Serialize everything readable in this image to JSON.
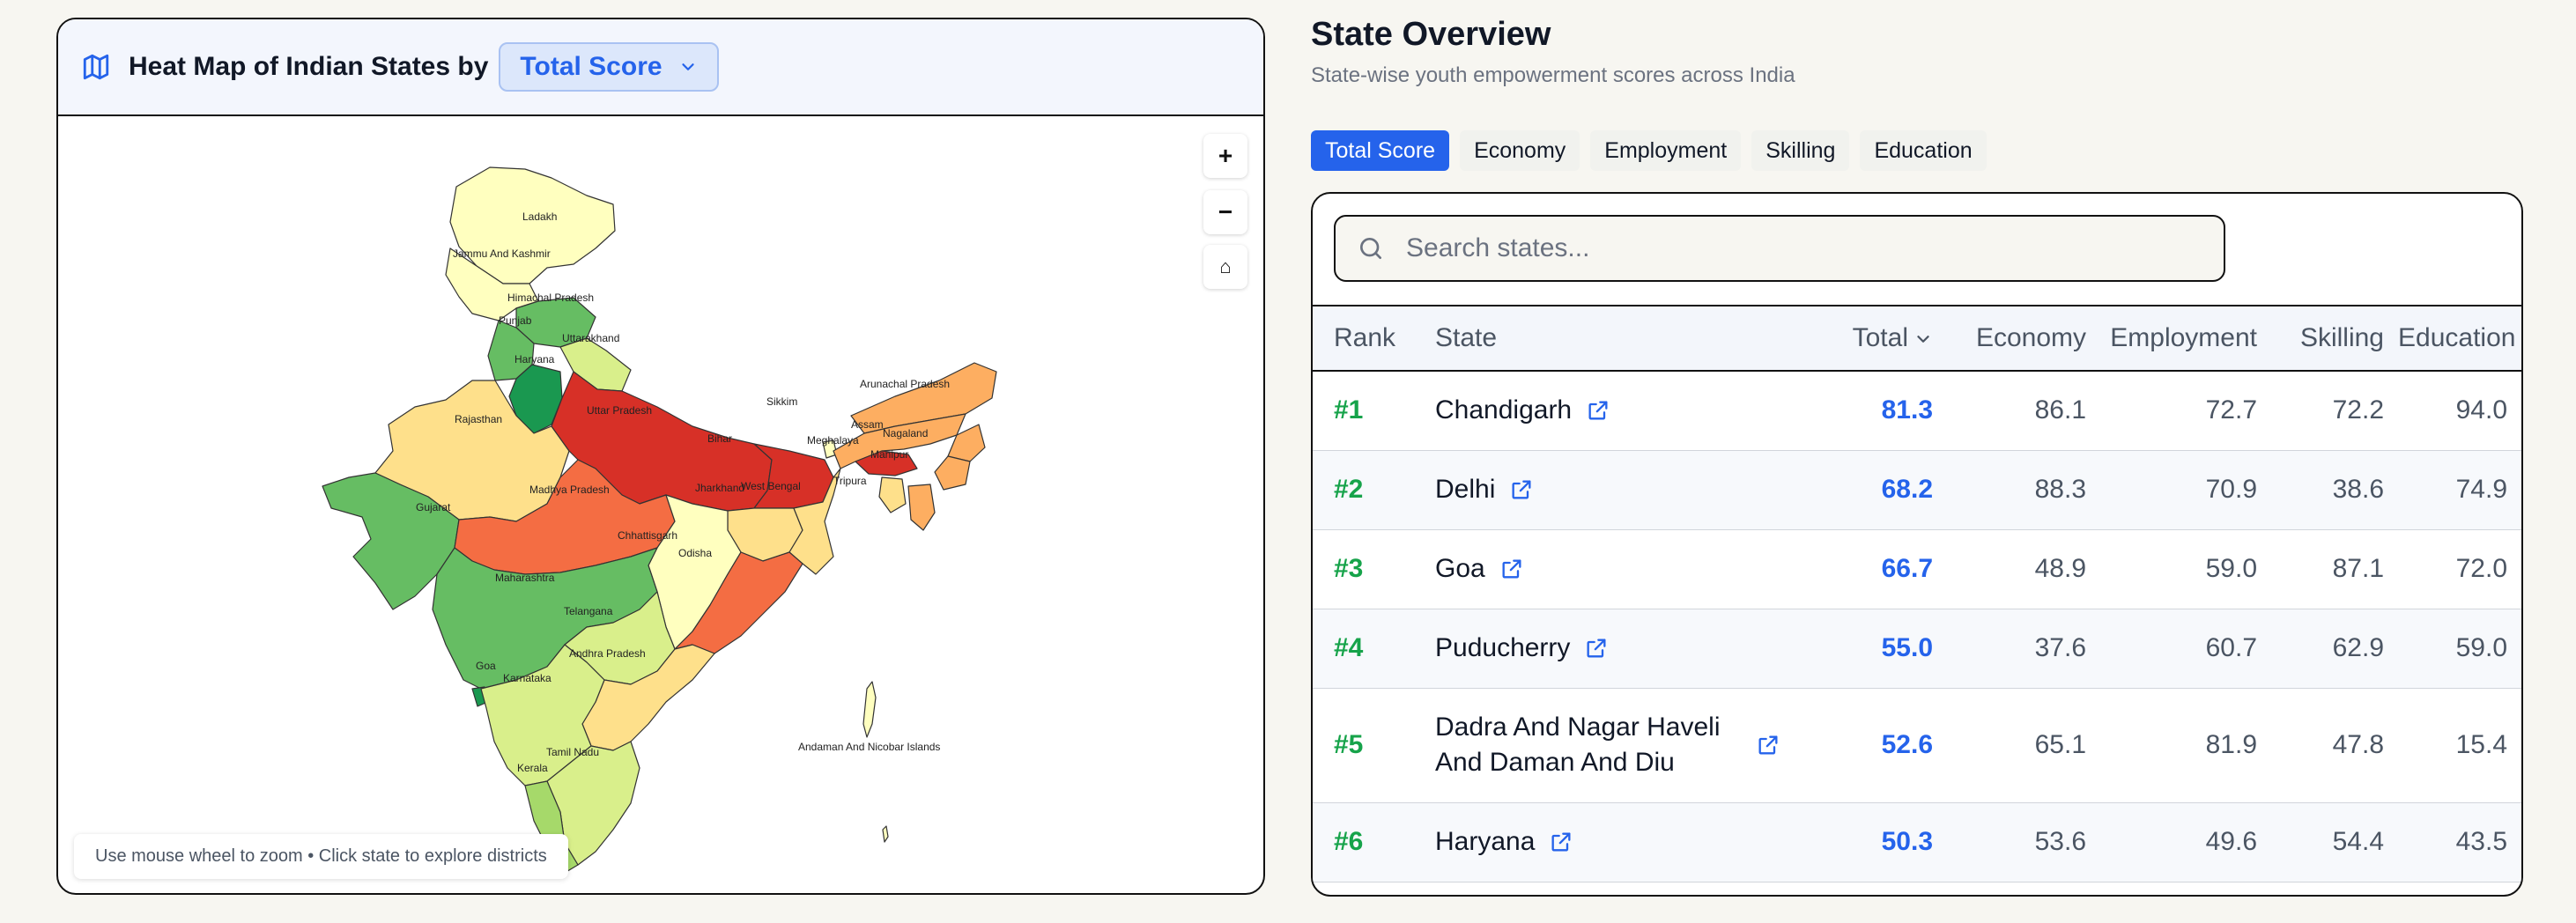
{
  "map": {
    "title": "Heat Map of Indian States by",
    "selected_metric": "Total Score",
    "hint": "Use mouse wheel to zoom • Click state to explore districts",
    "zoom_in": "+",
    "zoom_out": "−",
    "reset": "⌂",
    "labels": {
      "ladakh": "Ladakh",
      "jk": "Jammu And Kashmir",
      "hp": "Himachal Pradesh",
      "punjab": "Punjab",
      "uttarakhand": "Uttarakhand",
      "haryana": "Haryana",
      "rajasthan": "Rajasthan",
      "up": "Uttar Pradesh",
      "bihar": "Bihar",
      "sikkim": "Sikkim",
      "arunachal": "Arunachal Pradesh",
      "assam": "Assam",
      "nagaland": "Nagaland",
      "meghalaya": "Meghalaya",
      "manipur": "Manipur",
      "tripura": "Tripura",
      "gujarat": "Gujarat",
      "mp": "Madhya Pradesh",
      "jharkhand": "Jharkhand",
      "wb": "West Bengal",
      "chhattisgarh": "Chhattisgarh",
      "odisha": "Odisha",
      "maharashtra": "Maharashtra",
      "telangana": "Telangana",
      "ap": "Andhra Pradesh",
      "goa": "Goa",
      "karnataka": "Karnataka",
      "tn": "Tamil Nadu",
      "kerala": "Kerala",
      "andaman": "Andaman And Nicobar Islands"
    },
    "colors": {
      "dark_green": "#1a9850",
      "green": "#66bd63",
      "light_green": "#a6d96a",
      "yellow_green": "#d9ef8b",
      "pale_yellow": "#ffffbf",
      "light_orange": "#fee08b",
      "orange": "#fdae61",
      "dark_orange": "#f46d43",
      "red": "#d73027"
    }
  },
  "overview": {
    "title": "State Overview",
    "subtitle": "State-wise youth empowerment scores across India",
    "tabs": [
      "Total Score",
      "Economy",
      "Employment",
      "Skilling",
      "Education"
    ]
  },
  "table": {
    "search_placeholder": "Search states...",
    "columns": {
      "rank": "Rank",
      "state": "State",
      "total": "Total",
      "economy": "Economy",
      "employment": "Employment",
      "skilling": "Skilling",
      "education": "Education"
    },
    "rows": [
      {
        "rank": "#1",
        "state": "Chandigarh",
        "total": "81.3",
        "economy": "86.1",
        "employment": "72.7",
        "skilling": "72.2",
        "education": "94.0"
      },
      {
        "rank": "#2",
        "state": "Delhi",
        "total": "68.2",
        "economy": "88.3",
        "employment": "70.9",
        "skilling": "38.6",
        "education": "74.9"
      },
      {
        "rank": "#3",
        "state": "Goa",
        "total": "66.7",
        "economy": "48.9",
        "employment": "59.0",
        "skilling": "87.1",
        "education": "72.0"
      },
      {
        "rank": "#4",
        "state": "Puducherry",
        "total": "55.0",
        "economy": "37.6",
        "employment": "60.7",
        "skilling": "62.9",
        "education": "59.0"
      },
      {
        "rank": "#5",
        "state": "Dadra And Nagar Haveli And Daman And Diu",
        "total": "52.6",
        "economy": "65.1",
        "employment": "81.9",
        "skilling": "47.8",
        "education": "15.4"
      },
      {
        "rank": "#6",
        "state": "Haryana",
        "total": "50.3",
        "economy": "53.6",
        "employment": "49.6",
        "skilling": "54.4",
        "education": "43.5"
      }
    ]
  }
}
